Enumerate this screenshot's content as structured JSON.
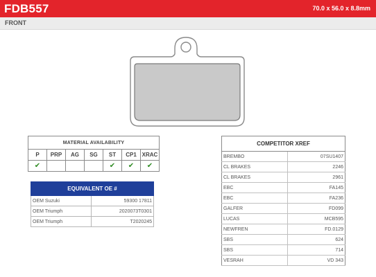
{
  "header": {
    "code": "FDB557",
    "dimensions": "70.0 x 56.0 x 8.8mm",
    "position": "FRONT",
    "brand_color": "#e3242b"
  },
  "material": {
    "title": "MATERIAL AVAILABILITY",
    "columns": [
      {
        "code": "P",
        "available": true
      },
      {
        "code": "PRP",
        "available": false
      },
      {
        "code": "AG",
        "available": false
      },
      {
        "code": "SG",
        "available": false
      },
      {
        "code": "ST",
        "available": true
      },
      {
        "code": "CP1",
        "available": true
      },
      {
        "code": "XRAC",
        "available": true
      }
    ],
    "check_symbol": "✔",
    "check_color": "#2e8b22"
  },
  "oe": {
    "title": "EQUIVALENT OE #",
    "header_color": "#1f3f9a",
    "rows": [
      {
        "brand": "OEM Suzuki",
        "ref": "59300 17811"
      },
      {
        "brand": "OEM Triumph",
        "ref": "2020073T0301"
      },
      {
        "brand": "OEM Triumph",
        "ref": "T2020245"
      }
    ]
  },
  "xref": {
    "title": "COMPETITOR XREF",
    "rows": [
      {
        "brand": "BREMBO",
        "ref": "07SU1407"
      },
      {
        "brand": "CL BRAKES",
        "ref": "2246"
      },
      {
        "brand": "CL BRAKES",
        "ref": "2961"
      },
      {
        "brand": "EBC",
        "ref": "FA145"
      },
      {
        "brand": "EBC",
        "ref": "FA236"
      },
      {
        "brand": "GALFER",
        "ref": "FD099"
      },
      {
        "brand": "LUCAS",
        "ref": "MCB595"
      },
      {
        "brand": "NEWFREN",
        "ref": "FD.0129"
      },
      {
        "brand": "SBS",
        "ref": "624"
      },
      {
        "brand": "SBS",
        "ref": "714"
      },
      {
        "brand": "VESRAH",
        "ref": "VD 343"
      }
    ]
  }
}
